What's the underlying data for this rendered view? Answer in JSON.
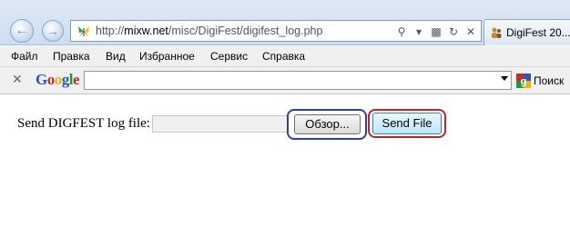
{
  "browser": {
    "url_prefix": "http://",
    "url_domain": "mixw.net",
    "url_path": "/misc/DigiFest/digifest_log.php",
    "tab_title": "DigiFest 20..."
  },
  "menu": {
    "items": [
      "Файл",
      "Правка",
      "Вид",
      "Избранное",
      "Сервис",
      "Справка"
    ]
  },
  "google_toolbar": {
    "logo_letters": [
      "G",
      "o",
      "o",
      "g",
      "l",
      "e"
    ],
    "search_value": "",
    "search_button_label": "Поиск"
  },
  "page": {
    "label": "Send DIGFEST log file:",
    "file_value": "",
    "browse_label": "Обзор...",
    "send_label": "Send File"
  },
  "colors": {
    "browse_highlight": "#2d3eb0",
    "send_highlight": "#c62028"
  },
  "icons": {
    "back": "back-arrow-icon",
    "forward": "forward-arrow-icon",
    "favicon": "butterfly-icon",
    "search": "magnifier-icon",
    "compat": "compatibility-view-icon",
    "refresh": "refresh-icon",
    "stop": "stop-icon",
    "tab": "people-icon"
  }
}
